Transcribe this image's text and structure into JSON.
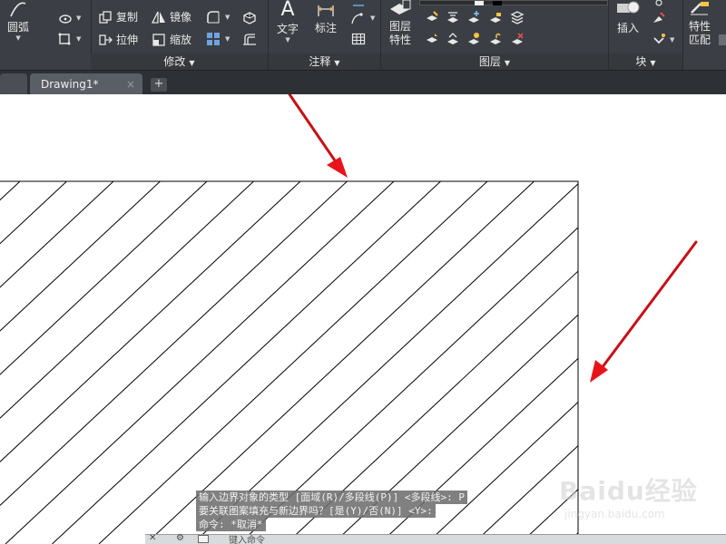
{
  "ribbon": {
    "draw_panel": {
      "arc_label": "圆弧"
    },
    "modify_panel": {
      "label": "修改",
      "copy_label": "复制",
      "mirror_label": "镜像",
      "stretch_label": "拉伸",
      "scale_label": "缩放"
    },
    "annotation_panel": {
      "label": "注释",
      "text_label": "文字",
      "dimension_label": "标注"
    },
    "layers_panel": {
      "label": "图层",
      "properties_line1": "图层",
      "properties_line2": "特性"
    },
    "block_panel": {
      "label": "块",
      "insert_label": "插入"
    },
    "properties_panel": {
      "match_line1": "特性",
      "match_line2": "匹配"
    }
  },
  "tabs": {
    "drawing_tab_label": "Drawing1*",
    "close_glyph": "×",
    "add_glyph": "+"
  },
  "command": {
    "history": [
      "输入边界对象的类型 [面域(R)/多段线(P)] <多段线>: P",
      "要关联图案填充与新边界吗？[是(Y)/否(N)] <Y>:",
      "命令: *取消*"
    ],
    "input_placeholder": "键入命令"
  },
  "watermark": {
    "logo_text": "Baidu经验",
    "sub_text": "jingyan.baidu.com"
  },
  "colors": {
    "ribbon_bg": "#3b3e44",
    "tabbar_bg": "#2d3035",
    "arrow_red": "#e8141b",
    "hatch_line": "#000000"
  }
}
